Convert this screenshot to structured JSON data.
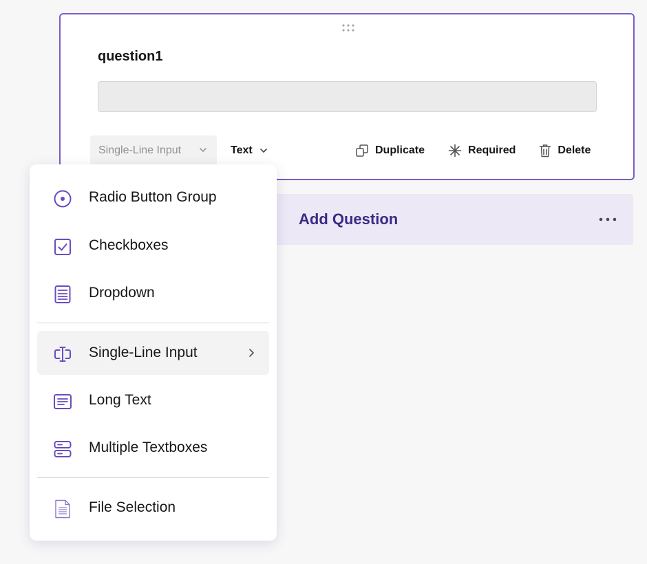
{
  "question": {
    "title": "question1",
    "input_value": "",
    "type_select": {
      "value": "Single-Line Input",
      "icon": "chevron-down-icon"
    },
    "format_select": {
      "value": "Text",
      "icon": "chevron-down-icon"
    },
    "actions": [
      {
        "label": "Duplicate",
        "icon": "duplicate-icon"
      },
      {
        "label": "Required",
        "icon": "asterisk-icon"
      },
      {
        "label": "Delete",
        "icon": "trash-icon"
      }
    ]
  },
  "add_question": {
    "label": "Add Question",
    "more_icon": "more-horizontal-icon"
  },
  "type_menu": {
    "groups": [
      [
        {
          "label": "Radio Button Group",
          "icon": "radio-icon"
        },
        {
          "label": "Checkboxes",
          "icon": "checkbox-icon"
        },
        {
          "label": "Dropdown",
          "icon": "dropdown-list-icon"
        }
      ],
      [
        {
          "label": "Single-Line Input",
          "icon": "text-cursor-icon",
          "selected": true,
          "has_submenu": true
        },
        {
          "label": "Long Text",
          "icon": "long-text-icon"
        },
        {
          "label": "Multiple Textboxes",
          "icon": "multiple-textboxes-icon"
        }
      ],
      [
        {
          "label": "File Selection",
          "icon": "file-icon"
        }
      ]
    ]
  },
  "colors": {
    "accent": "#7b5cc7",
    "accent_dark": "#3b2a85",
    "add_bar_bg": "#ece8f6",
    "page_bg": "#f7f7f7"
  }
}
